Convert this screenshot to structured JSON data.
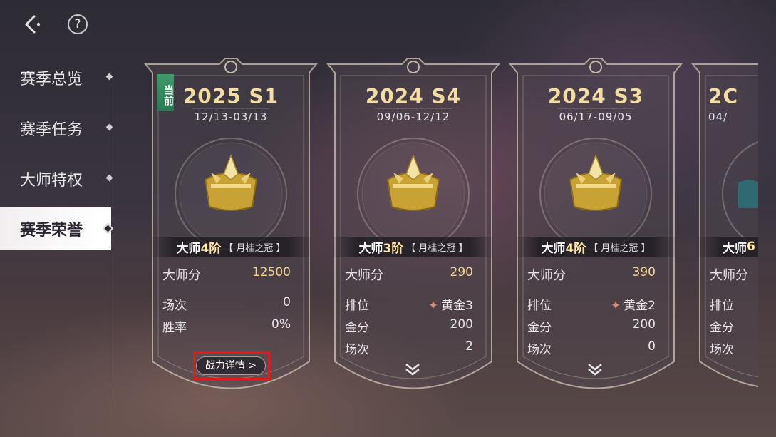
{
  "nav": {
    "back_icon": "back-arrow-icon",
    "help_label": "?"
  },
  "sidebar": {
    "items": [
      {
        "label": "赛季总览",
        "active": false
      },
      {
        "label": "赛季任务",
        "active": false
      },
      {
        "label": "大师特权",
        "active": false
      },
      {
        "label": "赛季荣誉",
        "active": true
      }
    ]
  },
  "colors": {
    "gold_title": "#f4dda0",
    "tier_highlight": "#ffe7a8",
    "current_tag": "#3f9a6c",
    "highlight_box": "#e11a1a"
  },
  "cards": [
    {
      "season": "2025 S1",
      "dates": "12/13-03/13",
      "current_tag": "当前",
      "rank_prefix": "大师",
      "rank_level": "4阶",
      "crown": "【 月桂之冠 】",
      "score_label": "大师分",
      "score_value": "12500",
      "rows": [
        {
          "label": "场次",
          "value": "0"
        },
        {
          "label": "胜率",
          "value": "0%"
        }
      ],
      "detail_button": "战力详情 >"
    },
    {
      "season": "2024 S4",
      "dates": "09/06-12/12",
      "rank_prefix": "大师",
      "rank_level": "3阶",
      "crown": "【 月桂之冠 】",
      "score_label": "大师分",
      "score_value": "290",
      "rows": [
        {
          "label": "排位",
          "value": "黄金3",
          "medal_icon": "gold-rank-medal-icon"
        },
        {
          "label": "金分",
          "value": "200"
        },
        {
          "label": "场次",
          "value": "2"
        }
      ],
      "expand_icon": "double-chevron-down-icon"
    },
    {
      "season": "2024 S3",
      "dates": "06/17-09/05",
      "rank_prefix": "大师",
      "rank_level": "4阶",
      "crown": "【 月桂之冠 】",
      "score_label": "大师分",
      "score_value": "390",
      "rows": [
        {
          "label": "排位",
          "value": "黄金2",
          "medal_icon": "gold-rank-medal-icon"
        },
        {
          "label": "金分",
          "value": "200"
        },
        {
          "label": "场次",
          "value": "0"
        }
      ],
      "expand_icon": "double-chevron-down-icon"
    },
    {
      "season": "2C",
      "dates": "04/",
      "rank_prefix": "大师",
      "rank_level": "6",
      "score_label": "大师分",
      "rows": [
        {
          "label": "排位",
          "value": ""
        },
        {
          "label": "金分",
          "value": ""
        },
        {
          "label": "场次",
          "value": ""
        }
      ]
    }
  ]
}
